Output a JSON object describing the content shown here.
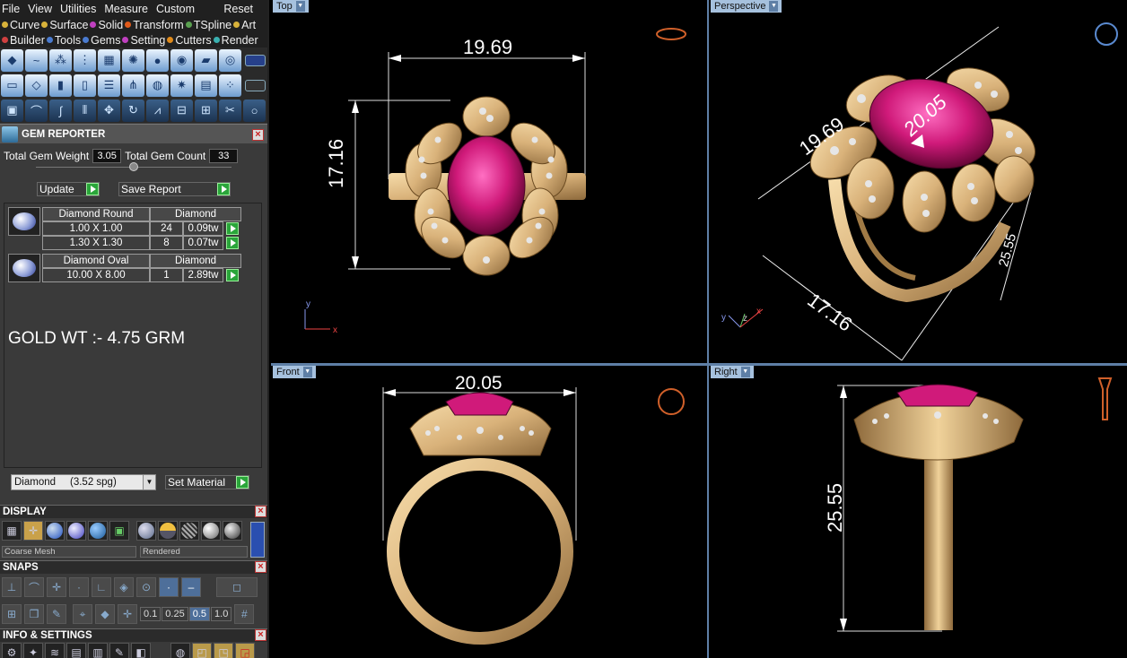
{
  "menu": [
    "File",
    "View",
    "Utilities",
    "Measure",
    "Custom"
  ],
  "menu_reset": "Reset",
  "tabs_row1": [
    {
      "label": "Curve",
      "color": "#d8b23a"
    },
    {
      "label": "Surface",
      "color": "#d8b23a"
    },
    {
      "label": "Solid",
      "color": "#c040c0"
    },
    {
      "label": "Transform",
      "color": "#e05a1a"
    },
    {
      "label": "TSpline",
      "color": "#5aa050"
    },
    {
      "label": "Art",
      "color": "#d8b23a"
    }
  ],
  "tabs_row2": [
    {
      "label": "Builder",
      "color": "#d04040"
    },
    {
      "label": "Tools",
      "color": "#4a7bd0"
    },
    {
      "label": "Gems",
      "color": "#4a7bd0"
    },
    {
      "label": "Setting",
      "color": "#c040c0"
    },
    {
      "label": "Cutters",
      "color": "#e08a1a"
    },
    {
      "label": "Render",
      "color": "#3ab0b0"
    }
  ],
  "gem_reporter": {
    "title": "GEM REPORTER",
    "total_weight_label": "Total Gem Weight",
    "total_weight": "3.05",
    "total_count_label": "Total Gem Count",
    "total_count": "33",
    "update_label": "Update",
    "save_report_label": "Save Report",
    "gems": [
      {
        "shape": "Diamond Round",
        "material": "Diamond",
        "rows": [
          {
            "size": "1.00 X 1.00",
            "count": "24",
            "weight": "0.09tw"
          },
          {
            "size": "1.30 X 1.30",
            "count": "8",
            "weight": "0.07tw"
          }
        ]
      },
      {
        "shape": "Diamond Oval",
        "material": "Diamond",
        "rows": [
          {
            "size": "10.00 X 8.00",
            "count": "1",
            "weight": "2.89tw"
          }
        ]
      }
    ],
    "note": "GOLD WT :- 4.75 GRM",
    "material_select": "Diamond     (3.52 spg)",
    "set_material_label": "Set Material"
  },
  "display": {
    "title": "DISPLAY",
    "mesh_select": "Coarse Mesh",
    "render_select": "Rendered"
  },
  "snaps": {
    "title": "SNAPS",
    "values": [
      "0.1",
      "0.25",
      "0.5",
      "1.0"
    ],
    "active_value": "0.5"
  },
  "info": {
    "title": "INFO & SETTINGS"
  },
  "viewports": {
    "top": {
      "label": "Top",
      "dim_width": "19.69",
      "dim_height": "17.16"
    },
    "perspective": {
      "label": "Perspective",
      "dim_a": "19.69",
      "dim_b": "20.05",
      "dim_c": "25.55",
      "dim_d": "17.16"
    },
    "front": {
      "label": "Front",
      "dim_width": "20.05"
    },
    "right": {
      "label": "Right",
      "dim_height": "25.55"
    }
  },
  "colors": {
    "gold": "#d9b27a",
    "ruby": "#d01a7a",
    "viewport_border": "#5e7fa6",
    "tab_bg": "#a6c1de"
  }
}
